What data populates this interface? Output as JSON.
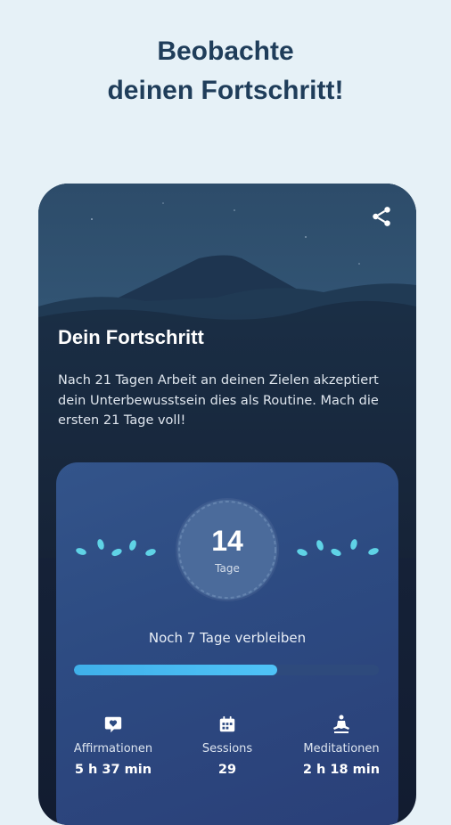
{
  "headline": {
    "line1": "Beobachte",
    "line2": "deinen Fortschritt!"
  },
  "screen": {
    "title": "Dein Fortschritt",
    "description": "Nach 21 Tagen Arbeit an deinen Zielen akzeptiert dein Unterbewusstsein dies als Routine. Mach die ersten 21 Tage voll!",
    "share_icon": "share-icon"
  },
  "progress": {
    "days": "14",
    "days_label": "Tage",
    "remaining_prefix": "Noch",
    "remaining_count": "7",
    "remaining_suffix": "Tage verbleiben",
    "completed_fraction": 0.6667
  },
  "stats": [
    {
      "icon": "heart-message-icon",
      "label": "Affirmationen",
      "value": "5 h 37 min"
    },
    {
      "icon": "calendar-icon",
      "label": "Sessions",
      "value": "29"
    },
    {
      "icon": "meditation-icon",
      "label": "Meditationen",
      "value": "2 h 18 min"
    }
  ],
  "colors": {
    "background": "#e6f1f7",
    "headline": "#1f3d5a",
    "accent": "#4fc3f7",
    "leaf": "#5fd3e6"
  }
}
